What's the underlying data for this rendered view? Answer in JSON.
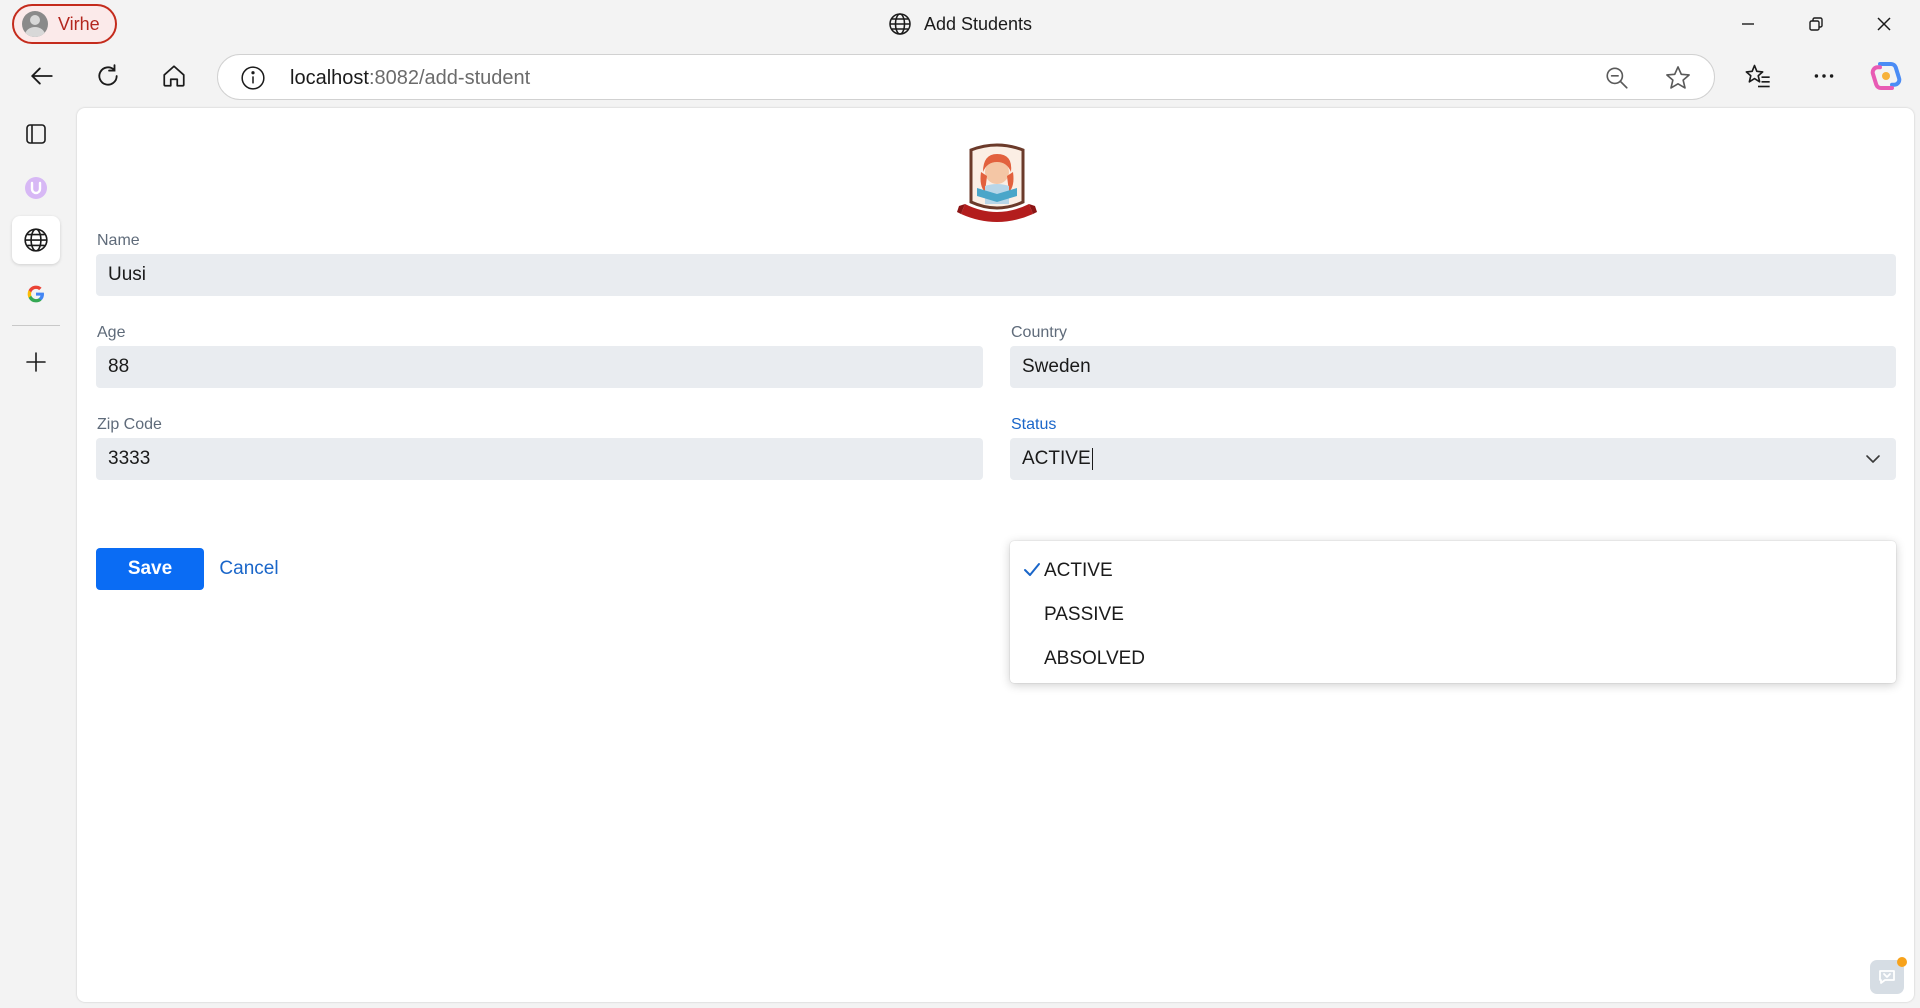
{
  "titlebar": {
    "profile_name": "Virhe",
    "window_title": "Add Students"
  },
  "toolbar": {
    "url_host": "localhost",
    "url_path": ":8082/add-student"
  },
  "form": {
    "name_label": "Name",
    "name_value": "Uusi",
    "age_label": "Age",
    "age_value": "88",
    "country_label": "Country",
    "country_value": "Sweden",
    "zip_label": "Zip Code",
    "zip_value": "3333",
    "status_label": "Status",
    "status_value": "ACTIVE",
    "save_label": "Save",
    "cancel_label": "Cancel"
  },
  "status_options": [
    {
      "label": "ACTIVE",
      "selected": true
    },
    {
      "label": "PASSIVE",
      "selected": false
    },
    {
      "label": "ABSOLVED",
      "selected": false
    }
  ],
  "colors": {
    "accent": "#0a6cf4",
    "link": "#1a66c9",
    "profile_border": "#c42b1c"
  },
  "icons": {
    "back": "back-arrow-icon",
    "refresh": "refresh-icon",
    "home": "home-icon",
    "info": "info-icon",
    "zoom": "zoom-out-icon",
    "favorite": "star-icon",
    "favorites": "favorites-icon",
    "more": "more-icon",
    "copilot": "copilot-icon"
  }
}
